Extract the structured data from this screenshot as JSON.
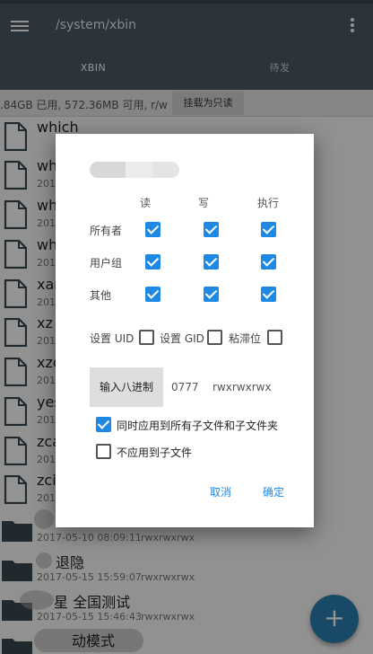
{
  "appbar": {
    "path": "/system/xbin",
    "tabs": [
      {
        "label": "XBIN",
        "active": true
      },
      {
        "label": "待发",
        "active": false
      }
    ],
    "icons": {
      "menu": "hamburger-menu-icon",
      "overflow": "more-vert-icon"
    }
  },
  "storage": {
    "text": ".84GB 已用, 572.36MB 可用, r/w",
    "mount_button": "挂载为只读"
  },
  "files": [
    {
      "name": "which",
      "type": "file",
      "meta": "",
      "perm": ""
    },
    {
      "name": "wh",
      "type": "file",
      "meta": "201",
      "perm": ""
    },
    {
      "name": "wh",
      "type": "file",
      "meta": "201",
      "perm": ""
    },
    {
      "name": "wh",
      "type": "file",
      "meta": "201",
      "perm": ""
    },
    {
      "name": "xar",
      "type": "file",
      "meta": "201",
      "perm": ""
    },
    {
      "name": "xz",
      "type": "file",
      "meta": "201",
      "perm": ""
    },
    {
      "name": "xzc",
      "type": "file",
      "meta": "201",
      "perm": ""
    },
    {
      "name": "yes",
      "type": "file",
      "meta": "201",
      "perm": ""
    },
    {
      "name": "zca",
      "type": "file",
      "meta": "201",
      "perm": ""
    },
    {
      "name": "zci",
      "type": "file",
      "meta": "201",
      "perm": ""
    },
    {
      "name": "",
      "type": "folder",
      "meta": "2017-05-10 08:09:11",
      "perm": "rwxrwxrwx"
    },
    {
      "name": "退隐",
      "type": "folder",
      "meta": "2017-05-15 15:59:07",
      "perm": "rwxrwxrwx"
    },
    {
      "name": "星 全国测试",
      "type": "folder",
      "meta": "2017-05-15 15:46:43",
      "perm": "rwxrwxrwx"
    },
    {
      "name": "动模式",
      "type": "folder",
      "meta": "",
      "perm": ""
    }
  ],
  "fab": {
    "label": "+",
    "icon": "add-icon"
  },
  "dialog": {
    "columns": [
      "读",
      "写",
      "执行"
    ],
    "rows": [
      {
        "label": "所有者",
        "values": [
          true,
          true,
          true
        ]
      },
      {
        "label": "用户组",
        "values": [
          true,
          true,
          true
        ]
      },
      {
        "label": "其他",
        "values": [
          true,
          true,
          true
        ]
      }
    ],
    "special": [
      {
        "label": "设置 UID",
        "checked": false
      },
      {
        "label": "设置 GID",
        "checked": false
      },
      {
        "label": "粘滞位",
        "checked": false
      }
    ],
    "octal_button": "输入八进制",
    "octal_value": "0777",
    "perm_string": "rwxrwxrwx",
    "options": [
      {
        "label": "同时应用到所有子文件和子文件夹",
        "checked": true
      },
      {
        "label": "不应用到子文件",
        "checked": false
      }
    ],
    "cancel": "取消",
    "ok": "确定"
  },
  "colors": {
    "appbar": "#4a5b66",
    "accent": "#1e88e5",
    "fab": "#2a7fb0"
  }
}
